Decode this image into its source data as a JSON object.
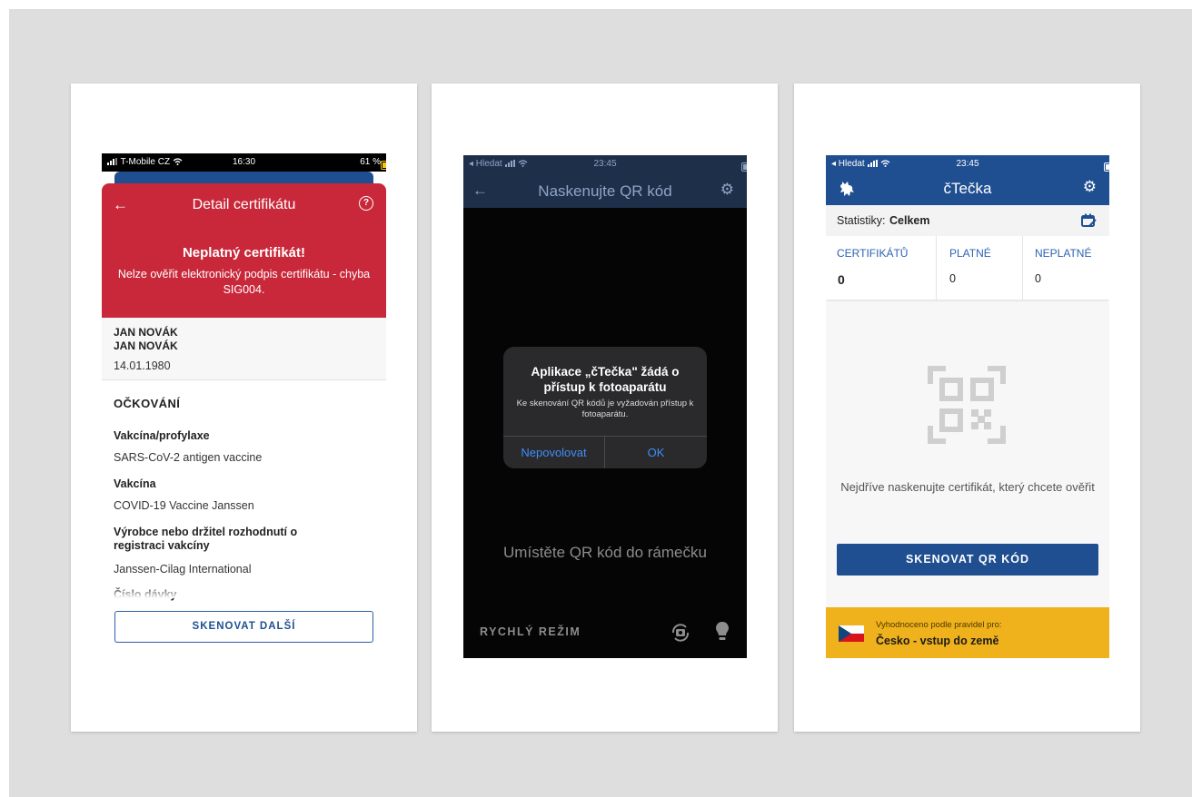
{
  "certificate_detail": {
    "status_bar": {
      "carrier": "T-Mobile CZ",
      "time": "16:30",
      "battery": "61 %"
    },
    "title": "Detail certifikátu",
    "error_title": "Neplatný certifikát!",
    "error_message": "Nelze ověřit elektronický podpis certifikátu - chyba SIG004.",
    "person": {
      "name_line1": "JAN NOVÁK",
      "name_line2": "JAN NOVÁK",
      "birth_date": "14.01.1980"
    },
    "section_title": "OČKOVÁNÍ",
    "fields": [
      {
        "label": "Vakcína/profylaxe",
        "value": "SARS-CoV-2 antigen vaccine"
      },
      {
        "label": "Vakcína",
        "value": "COVID-19 Vaccine Janssen"
      },
      {
        "label": "Výrobce nebo držitel rozhodnutí o registraci vakcíny",
        "value": "Janssen-Cilag International"
      },
      {
        "label": "Číslo dávky",
        "value": ""
      }
    ],
    "scan_next_button": "SKENOVAT DALŠÍ"
  },
  "scanner": {
    "status_bar": {
      "left": "◂ Hledat",
      "time": "23:45"
    },
    "title": "Naskenujte QR kód",
    "dialog": {
      "title": "Aplikace „čTečka\" žádá o přístup k fotoaparátu",
      "message": "Ke skenování QR kódů je vyžadován přístup k fotoaparátu.",
      "deny": "Nepovolovat",
      "allow": "OK"
    },
    "hint": "Umístěte QR kód do rámečku",
    "fast_mode": "RYCHLÝ REŽIM"
  },
  "home": {
    "status_bar": {
      "left": "◂ Hledat",
      "time": "23:45"
    },
    "title": "čTečka",
    "stats_label": "Statistiky:",
    "stats_value": "Celkem",
    "counts": [
      {
        "label": "CERTIFIKÁTŮ",
        "value": "0"
      },
      {
        "label": "PLATNÉ",
        "value": "0"
      },
      {
        "label": "NEPLATNÉ",
        "value": "0"
      }
    ],
    "empty_message": "Nejdříve naskenujte certifikát, který chcete ověřit",
    "scan_button": "SKENOVAT QR KÓD",
    "rules_small": "Vyhodnoceno podle pravidel pro:",
    "rules_big": "Česko - vstup do země"
  },
  "colors": {
    "error_red": "#c9283a",
    "brand_blue": "#1f4f91",
    "link_blue": "#3d8ef7",
    "footer_yellow": "#efb11c",
    "backdrop_gray": "#dedede"
  },
  "icons": [
    "back-arrow-icon",
    "help-icon",
    "gear-icon",
    "camera-flip-icon",
    "flashlight-icon",
    "lion-logo-icon",
    "calendar-edit-icon",
    "qr-placeholder-icon",
    "czech-flag-icon",
    "wifi-icon",
    "signal-icon",
    "battery-icon"
  ]
}
